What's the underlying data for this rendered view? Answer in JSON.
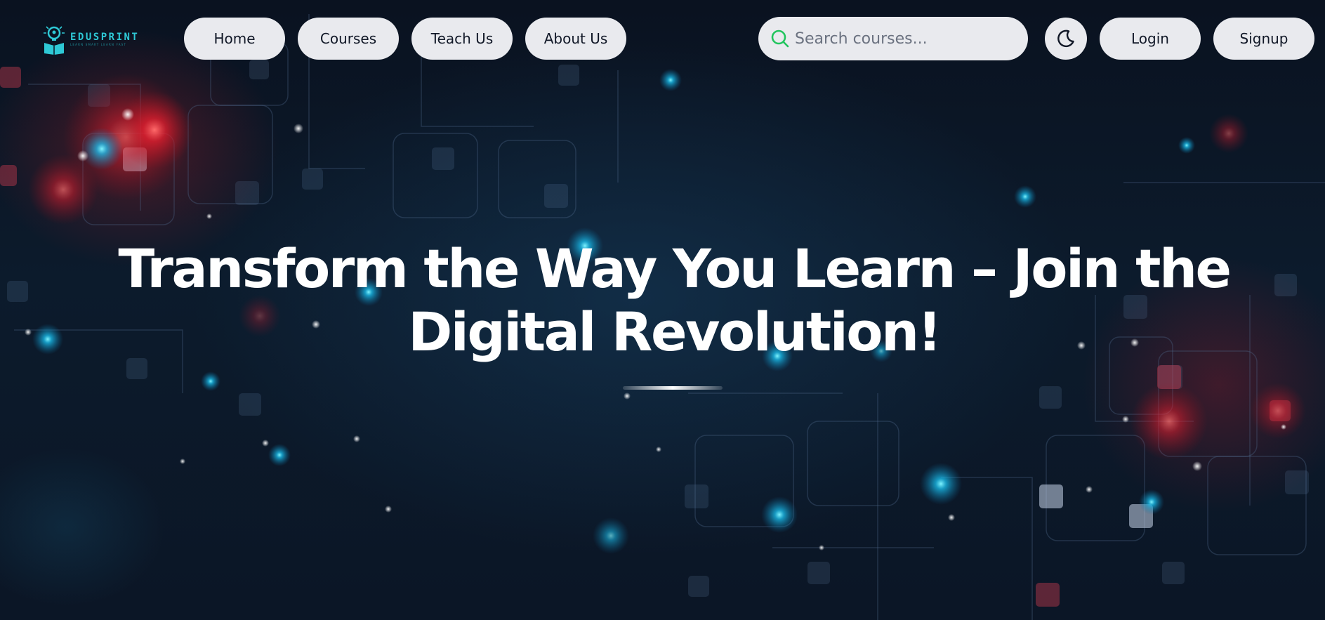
{
  "brand": {
    "name": "EDUSPRINT",
    "tagline": "LEARN SMART LEARN FAST",
    "accent": "#2ec9d6"
  },
  "nav": {
    "items": [
      {
        "label": "Home"
      },
      {
        "label": "Courses"
      },
      {
        "label": "Teach Us"
      },
      {
        "label": "About Us"
      }
    ]
  },
  "search": {
    "placeholder": "Search courses...",
    "value": "",
    "icon": "search-icon",
    "icon_color": "#22c55e"
  },
  "theme_toggle": {
    "icon": "moon-icon"
  },
  "auth": {
    "login_label": "Login",
    "signup_label": "Signup"
  },
  "hero": {
    "headline": "Transform the Way You Learn – Join the Digital Revolution!",
    "text_color": "#ffffff",
    "background": "#0c1b2c"
  },
  "colors": {
    "pill_bg": "#e9eaee",
    "pill_text": "#111827"
  }
}
